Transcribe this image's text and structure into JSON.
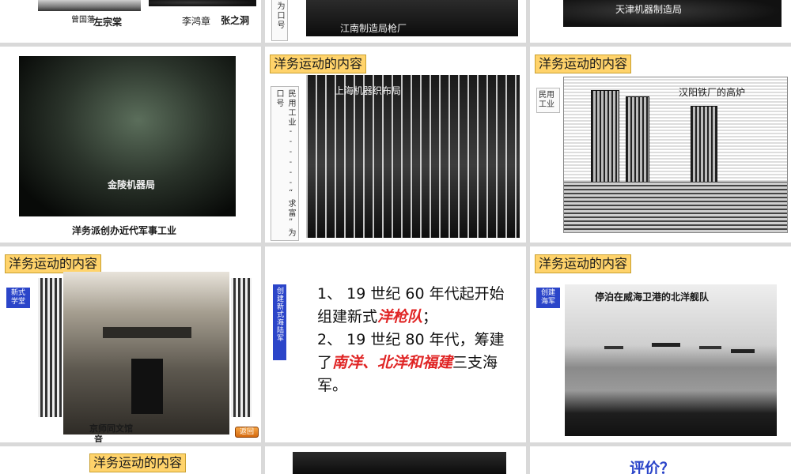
{
  "slides": {
    "s1": {
      "captions": [
        "曾国藩",
        "左宗棠",
        "李鸿章",
        "张之洞"
      ]
    },
    "s2": {
      "vertical_text": "为口号",
      "photo_caption": "江南制造局枪厂"
    },
    "s3": {
      "photo_caption": "天津机器制造局"
    },
    "s4": {
      "photo_label": "金陵机器局",
      "caption": "洋务派创办近代军事工业"
    },
    "s5": {
      "title": "洋务运动的内容",
      "vertical_text": "民用工业------“求富”为口号",
      "photo_caption": "上海机器织布局"
    },
    "s6": {
      "title": "洋务运动的内容",
      "side_label": "民用工业",
      "photo_caption": "汉阳铁厂的高炉"
    },
    "s7": {
      "title": "洋务运动的内容",
      "side_label": "新式学堂",
      "photo_caption": "京师同文馆",
      "photo_caption_2": "音",
      "nav_button": "返回"
    },
    "s8": {
      "side_label": "创建新式海陆军",
      "line1_num": "1",
      "line1_a": "、 19 世纪 60 年代起开始组建新式",
      "line1_em": "洋枪队",
      "line1_b": "；",
      "line2_num": "2",
      "line2_a": "、 19 世纪 80 年代，筹建了",
      "line2_em": "南洋、北洋和福建",
      "line2_b": "三支海军。"
    },
    "s9": {
      "title": "洋务运动的内容",
      "side_label": "创建海军",
      "photo_caption": "停泊在威海卫港的北洋舰队"
    },
    "s10": {
      "title": "洋务运动的内容"
    },
    "s12": {
      "title": "评价？"
    }
  }
}
